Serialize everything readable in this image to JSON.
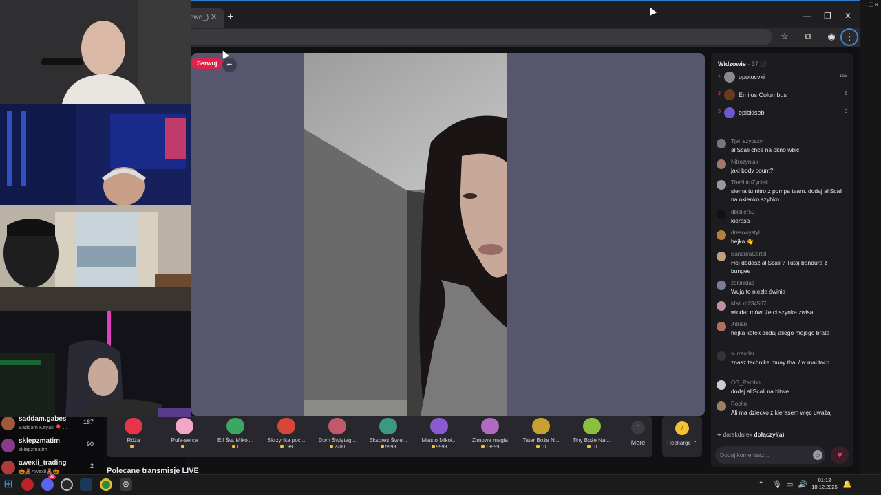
{
  "browser": {
    "tab_title": "owe_) ...",
    "window_controls": {
      "minimize": "—",
      "maximize": "❐",
      "close": "✕"
    }
  },
  "stream": {
    "serwuj_label": "Serwuj",
    "colors": {
      "stage": "#57566f",
      "accent": "#e0224a",
      "coin": "#f4c430"
    }
  },
  "gifts": [
    {
      "icon": "rose-icon",
      "name": "Róża",
      "price": "1",
      "color": "#e8344a"
    },
    {
      "icon": "heart-puff-icon",
      "name": "Pufa-serce",
      "price": "1",
      "color": "#f4a6c6"
    },
    {
      "icon": "elf-icon",
      "name": "Elf Św. Mikoł...",
      "price": "1",
      "color": "#3aa860"
    },
    {
      "icon": "mailbox-icon",
      "name": "Skrzynka poc...",
      "price": "199",
      "color": "#d8463a"
    },
    {
      "icon": "house-icon",
      "name": "Dom Święteg...",
      "price": "2200",
      "color": "#c05a6a"
    },
    {
      "icon": "train-icon",
      "name": "Ekspres Świę...",
      "price": "5999",
      "color": "#3a9a80"
    },
    {
      "icon": "city-icon",
      "name": "Miasto Mikoł...",
      "price": "9999",
      "color": "#8a5ad0"
    },
    {
      "icon": "magic-icon",
      "name": "Zimowa magia",
      "price": "19999",
      "color": "#b06ac0"
    },
    {
      "icon": "dad-icon",
      "name": "Tater Boże N...",
      "price": "10",
      "color": "#c8a030"
    },
    {
      "icon": "tiny-icon",
      "name": "Tiny Boże Nar...",
      "price": "10",
      "color": "#8ac040"
    }
  ],
  "gift_more_label": "More",
  "recharge_label": "Recharge ⌃",
  "recommended_title": "Polecane transmisje LIVE",
  "viewers": {
    "title": "Widzowie",
    "count": "· 37",
    "top": [
      {
        "rank": "1",
        "name": "opotocvki",
        "count": "169",
        "color": "#8a8a8a"
      },
      {
        "rank": "2",
        "name": "Emilos Columbus",
        "count": "6",
        "color": "#6a3a1a"
      },
      {
        "rank": "3",
        "name": "epickiseb",
        "count": "3",
        "color": "#6a5ad0"
      }
    ]
  },
  "chat": [
    {
      "user": "Tjel_szybszy",
      "text": "aliScali chce na okno wbić",
      "color": "#777"
    },
    {
      "user": "Nitrozyniak",
      "text": "jaki body count?",
      "color": "#a07a6a"
    },
    {
      "user": "TheNitroZyniak",
      "text": "siema tu nitro z pompa team. dodaj aliScali na okienko szybko",
      "color": "#9a9a9a"
    },
    {
      "user": "dbkiller59",
      "text": "kierasa",
      "color": "#111"
    },
    {
      "user": "dresowystyl",
      "text": "hejka 👋",
      "color": "#b08040"
    },
    {
      "user": "BanduraCartel",
      "text": "Hej dodasz aliScali ? Tutaj bandura z bungee",
      "color": "#c0a080"
    },
    {
      "user": "zolonidas",
      "text": "Wuja to niezła świnia",
      "color": "#7a7aa0"
    },
    {
      "user": "Mati.rp234567",
      "text": "wlodar mówi że ci szynka zwisa",
      "color": "#c090a0"
    },
    {
      "user": "Adrian",
      "text": "hejka kotek dodaj aliego mojego brata",
      "color": "#b07060"
    },
    {
      "user": "surrender",
      "text": "znasz technike muay thai / w mai tach",
      "color": "#333"
    },
    {
      "user": "OG_Rambo",
      "text": "dodaj aliScali na bitwe",
      "color": "#ccc"
    },
    {
      "user": "Rocho",
      "text": "Ali ma dziecko z kierasem więc uważaj",
      "color": "#a08060"
    }
  ],
  "join_event": {
    "user": "darekdarek",
    "text": "dołączył(a)"
  },
  "comment": {
    "placeholder": "Dodaj komentarz...",
    "value": ""
  },
  "sidebar_streamers": [
    {
      "name": "saddam.gabes",
      "sub": "Saddam Kayak 🎈 ...",
      "count": "187",
      "color": "#a05a3a"
    },
    {
      "name": "sklepzmatim",
      "sub": "sklepzmatim",
      "count": "90",
      "color": "#8a3a8a"
    },
    {
      "name": "awexii_trading",
      "sub": "🎃🧸Awexii🧸🎃",
      "count": "2",
      "color": "#b03a3a"
    }
  ],
  "taskbar": {
    "time": "01:12",
    "date": "18.12.2025",
    "notification_badge": "99"
  }
}
